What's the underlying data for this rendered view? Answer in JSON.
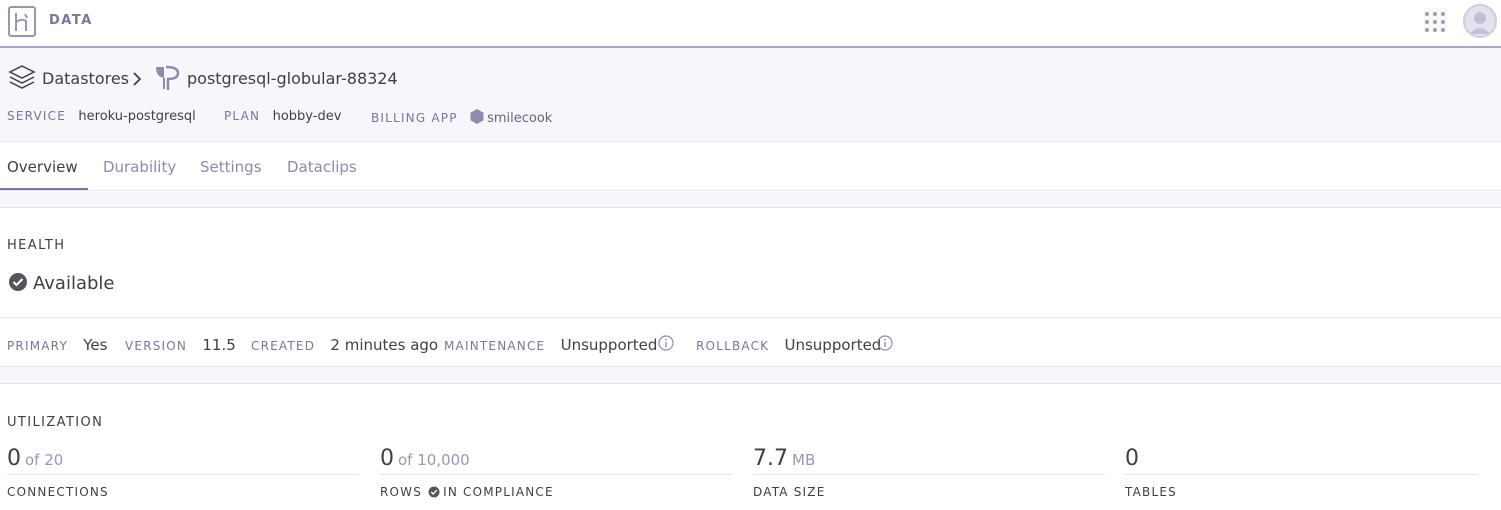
{
  "app": {
    "title": "DATA"
  },
  "breadcrumb": {
    "root": "Datastores",
    "current": "postgresql-globular-88324"
  },
  "meta": {
    "service_label": "SERVICE",
    "service": "heroku-postgresql",
    "plan_label": "PLAN",
    "plan": "hobby-dev",
    "billing_label": "BILLING APP",
    "billing_app": "smilecook"
  },
  "tabs": [
    "Overview",
    "Durability",
    "Settings",
    "Dataclips"
  ],
  "health": {
    "title": "HEALTH",
    "status": "Available",
    "primary_label": "PRIMARY",
    "primary": "Yes",
    "version_label": "VERSION",
    "version": "11.5",
    "created_label": "CREATED",
    "created": "2 minutes ago",
    "maintenance_label": "MAINTENANCE",
    "maintenance": "Unsupported",
    "rollback_label": "ROLLBACK",
    "rollback": "Unsupported"
  },
  "utilization": {
    "title": "UTILIZATION",
    "connections": {
      "value": "0",
      "sub": "of 20",
      "label": "CONNECTIONS"
    },
    "rows": {
      "value": "0",
      "sub": "of 10,000",
      "label": "ROWS",
      "compliance": "IN COMPLIANCE"
    },
    "data_size": {
      "value": "7.7",
      "sub": "MB",
      "label": "DATA SIZE"
    },
    "tables": {
      "value": "0",
      "label": "TABLES"
    }
  },
  "colors": {
    "accent": "#79759e",
    "rule": "#a9a3d4",
    "band": "#f6f7fb"
  },
  "icons": [
    "heroku-logo-icon",
    "apps-grid-icon",
    "avatar",
    "datastores-stack-icon",
    "chevron-right-icon",
    "postgres-elephant-icon",
    "app-hexagon-icon",
    "check-circle-icon",
    "info-icon"
  ]
}
